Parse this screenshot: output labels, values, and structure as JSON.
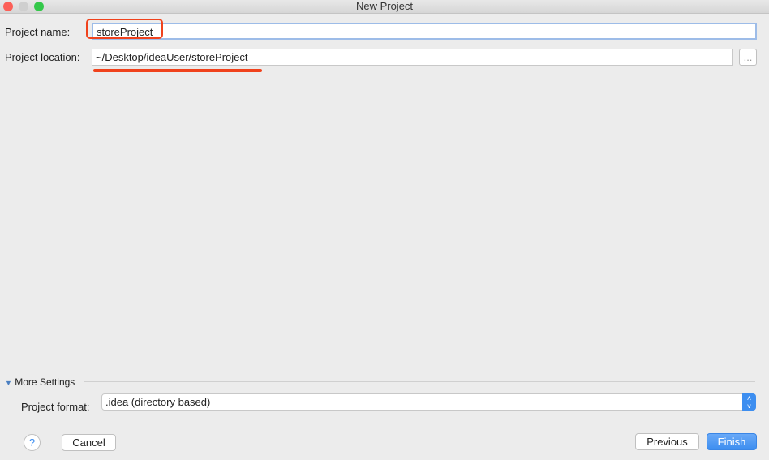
{
  "window": {
    "title": "New Project"
  },
  "form": {
    "name_label": "Project name:",
    "name_value": "storeProject",
    "location_label": "Project location:",
    "location_value": "~/Desktop/ideaUser/storeProject",
    "browse_label": "..."
  },
  "more_settings": {
    "label": "More Settings",
    "format_label": "Project format:",
    "format_value": ".idea (directory based)"
  },
  "buttons": {
    "help": "?",
    "cancel": "Cancel",
    "previous": "Previous",
    "finish": "Finish"
  },
  "colors": {
    "accent": "#3d8ef0",
    "highlight": "#f0421c"
  }
}
